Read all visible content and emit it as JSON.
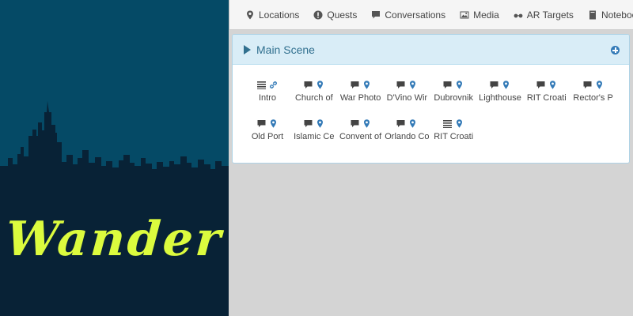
{
  "brand": {
    "logo_text": "Wander",
    "bg_color": "#054a66",
    "city_color": "#082236",
    "logo_color": "#dcfb3e"
  },
  "nav": [
    {
      "label": "Locations",
      "icon": "map-marker-icon"
    },
    {
      "label": "Quests",
      "icon": "exclamation-circle-icon"
    },
    {
      "label": "Conversations",
      "icon": "comment-icon"
    },
    {
      "label": "Media",
      "icon": "image-icon"
    },
    {
      "label": "AR Targets",
      "icon": "glasses-icon"
    },
    {
      "label": "Notebook",
      "icon": "book-icon"
    }
  ],
  "scene": {
    "title": "Main Scene",
    "nodes": [
      {
        "label": "Intro",
        "type": "list",
        "icon2": "link"
      },
      {
        "label": "Church of",
        "type": "comment",
        "icon2": "marker"
      },
      {
        "label": "War Photo",
        "type": "comment",
        "icon2": "marker"
      },
      {
        "label": "D'Vino Wir",
        "type": "comment",
        "icon2": "marker"
      },
      {
        "label": "Dubrovnik",
        "type": "comment",
        "icon2": "marker"
      },
      {
        "label": "Lighthouse",
        "type": "comment",
        "icon2": "marker"
      },
      {
        "label": "RIT Croati",
        "type": "comment",
        "icon2": "marker"
      },
      {
        "label": "Rector's P",
        "type": "comment",
        "icon2": "marker"
      },
      {
        "label": "Old Port",
        "type": "comment",
        "icon2": "marker"
      },
      {
        "label": "Islamic Ce",
        "type": "comment",
        "icon2": "marker"
      },
      {
        "label": "Convent of",
        "type": "comment",
        "icon2": "marker"
      },
      {
        "label": "Orlando Co",
        "type": "comment",
        "icon2": "marker"
      },
      {
        "label": "RIT Croati",
        "type": "list",
        "icon2": "marker"
      }
    ]
  },
  "colors": {
    "accent": "#337ab7",
    "panel_head_bg": "#d9edf7",
    "panel_title": "#31708f"
  }
}
